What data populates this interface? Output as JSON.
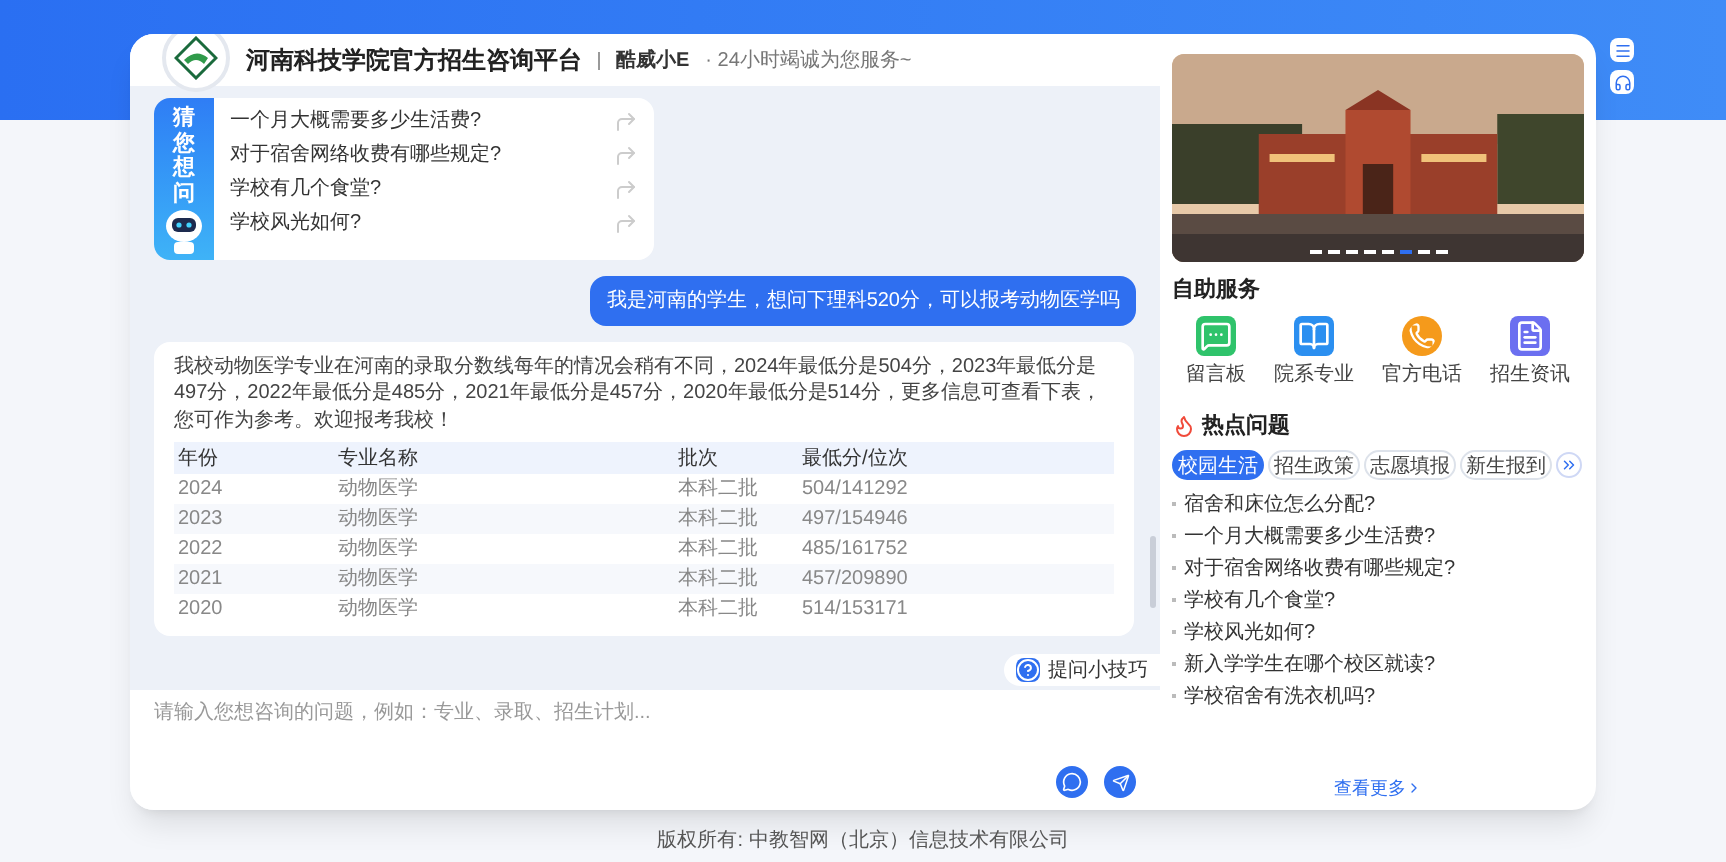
{
  "header": {
    "title": "河南科技学院官方招生咨询平台",
    "assistant": "酷威小E",
    "tagline": "· 24小时竭诚为您服务~"
  },
  "guess": {
    "title": "猜您想问",
    "questions": [
      "一个月大概需要多少生活费?",
      "对于宿舍网络收费有哪些规定?",
      "学校有几个食堂?",
      "学校风光如何?"
    ]
  },
  "user_message": "我是河南的学生，想问下理科520分，可以报考动物医学吗",
  "bot_message": {
    "text": "我校动物医学专业在河南的录取分数线每年的情况会稍有不同，2024年最低分是504分，2023年最低分是497分，2022年最低分是485分，2021年最低分是457分，2020年最低分是514分，更多信息可查看下表，您可作为参考。欢迎报考我校！",
    "table": {
      "columns": [
        "年份",
        "专业名称",
        "批次",
        "最低分/位次"
      ],
      "rows": [
        [
          "2024",
          "动物医学",
          "本科二批",
          "504/141292"
        ],
        [
          "2023",
          "动物医学",
          "本科二批",
          "497/154946"
        ],
        [
          "2022",
          "动物医学",
          "本科二批",
          "485/161752"
        ],
        [
          "2021",
          "动物医学",
          "本科二批",
          "457/209890"
        ],
        [
          "2020",
          "动物医学",
          "本科二批",
          "514/153171"
        ]
      ]
    }
  },
  "tips_button": "提问小技巧",
  "input": {
    "placeholder": "请输入您想咨询的问题，例如：专业、录取、招生计划..."
  },
  "carousel": {
    "dots": [
      {
        "selected": false
      },
      {
        "selected": false
      },
      {
        "selected": false
      },
      {
        "selected": false
      },
      {
        "selected": false
      },
      {
        "selected": true
      },
      {
        "selected": false
      },
      {
        "selected": false
      }
    ]
  },
  "self_service": {
    "title": "自助服务",
    "items": [
      {
        "kind": "message",
        "label": "留言板"
      },
      {
        "kind": "book",
        "label": "院系专业"
      },
      {
        "kind": "phone",
        "label": "官方电话"
      },
      {
        "kind": "document",
        "label": "招生资讯"
      }
    ]
  },
  "hot": {
    "title": "热点问题",
    "tabs": [
      {
        "label": "校园生活",
        "selected": true
      },
      {
        "label": "招生政策",
        "selected": false
      },
      {
        "label": "志愿填报",
        "selected": false
      },
      {
        "label": "新生报到",
        "selected": false
      }
    ],
    "questions": [
      "宿舍和床位怎么分配?",
      "一个月大概需要多少生活费?",
      "对于宿舍网络收费有哪些规定?",
      "学校有几个食堂?",
      "学校风光如何?",
      "新入学学生在哪个校区就读?",
      "学校宿舍有洗衣机吗?"
    ],
    "more": "查看更多"
  },
  "footer": "版权所有: 中教智网（北京）信息技术有限公司"
}
